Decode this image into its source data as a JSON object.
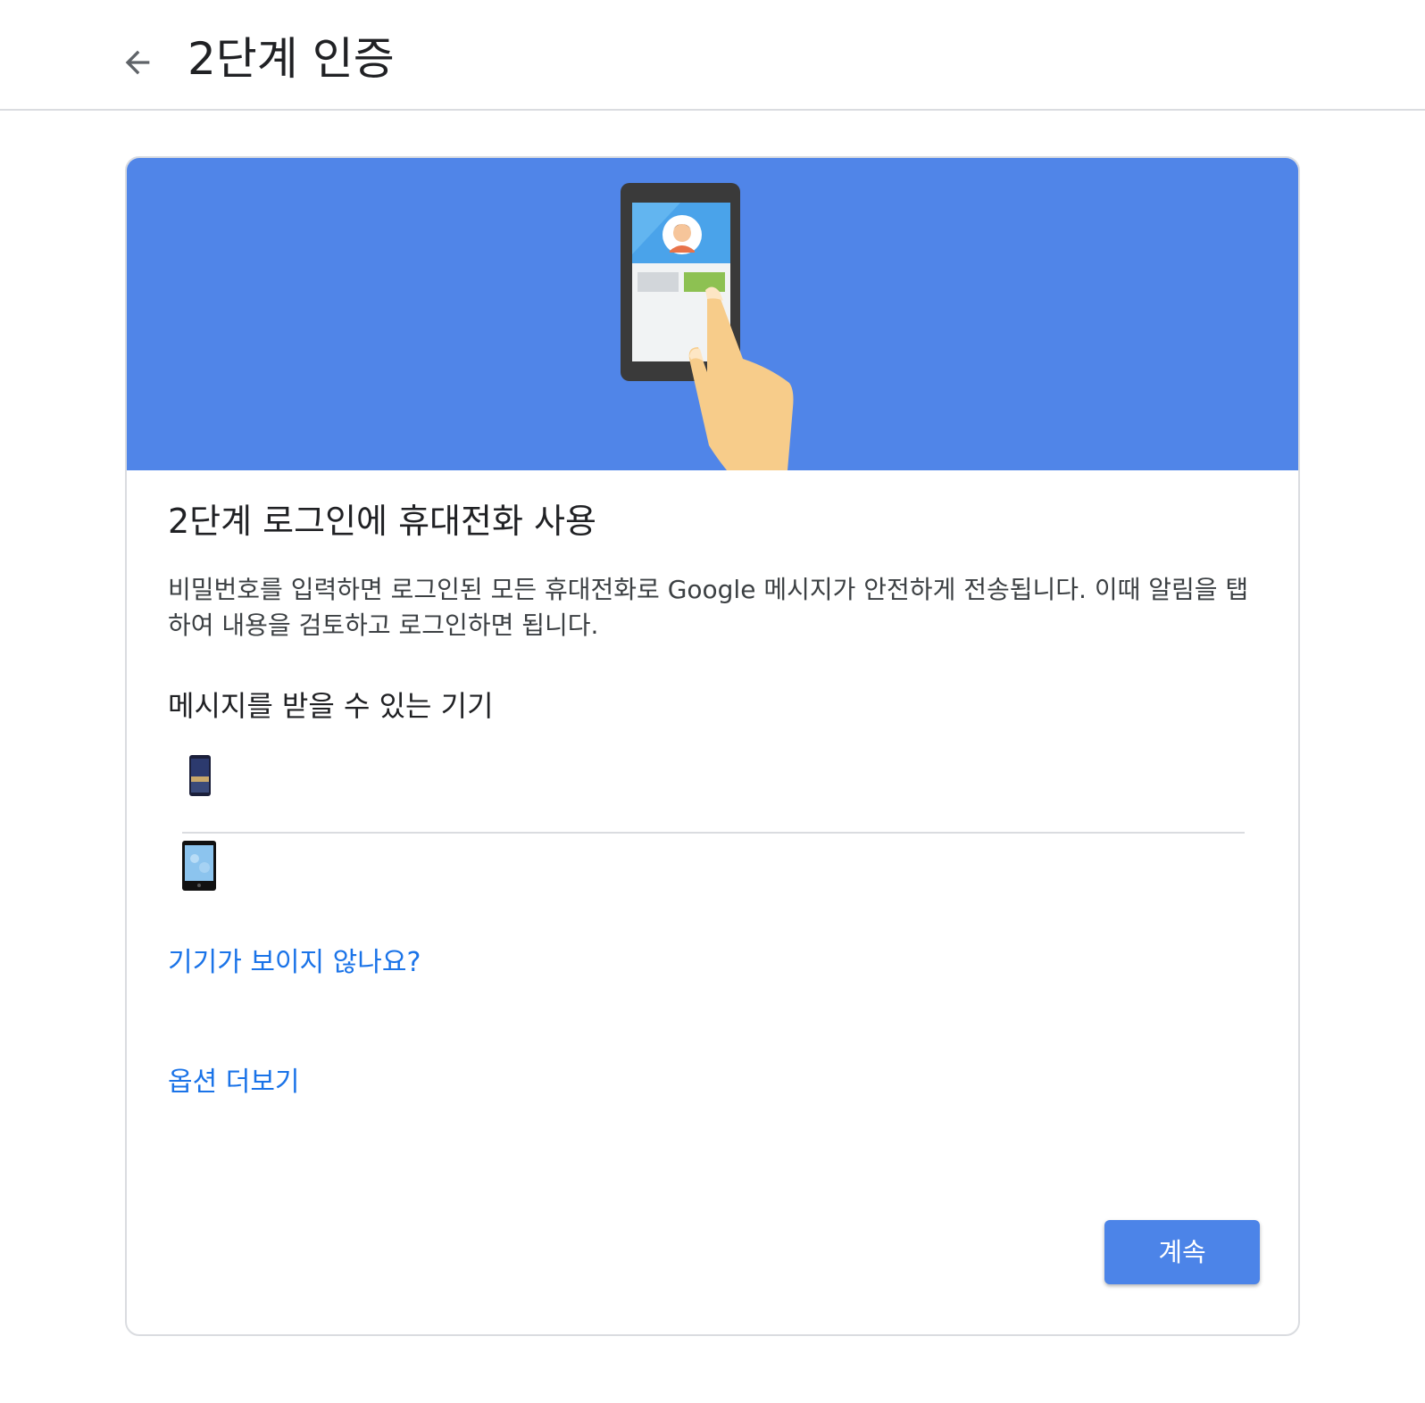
{
  "header": {
    "back_icon": "arrow-back-icon",
    "title": "2단계 인증"
  },
  "hero": {
    "illustration": "phone-tap-illustration",
    "background_color": "#5085e8"
  },
  "card": {
    "title": "2단계 로그인에 휴대전화 사용",
    "description": "비밀번호를 입력하면 로그인된 모든 휴대전화로 Google 메시지가 안전하게 전송됩니다. 이때 알림을 탭하여 내용을 검토하고 로그인하면 됩니다.",
    "devices_heading": "메시지를 받을 수 있는 기기",
    "devices": [
      {
        "icon": "smartphone-icon"
      },
      {
        "icon": "tablet-icon"
      }
    ],
    "missing_device_link": "기기가 보이지 않나요?",
    "more_options_link": "옵션 더보기",
    "continue_label": "계속"
  },
  "colors": {
    "accent": "#1a73e8",
    "button": "#4c84e8",
    "divider": "#dadce0"
  }
}
